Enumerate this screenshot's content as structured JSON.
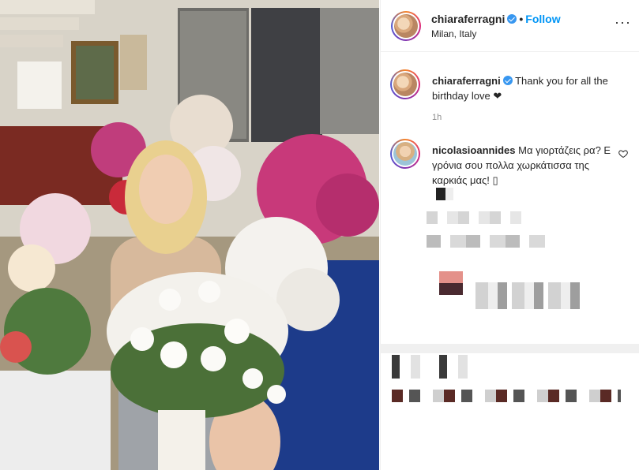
{
  "post": {
    "username": "chiaraferragni",
    "follow_label": "Follow",
    "dot": "•",
    "location": "Milan, Italy",
    "more_icon": "more-options-icon",
    "more_glyph": "···",
    "caption_text": "Thank you for all the birthday love ❤",
    "time_ago": "1h"
  },
  "comments": [
    {
      "username": "nicolasioannides",
      "text": "Μα γιορτάζεις ρα? Ε γρόνια σου πολλα χωρκάτισσα της καρκιάς μας! ▯",
      "icon": "heart-icon"
    }
  ],
  "colors": {
    "link_blue": "#0095f6",
    "verified_blue": "#3897f0",
    "muted_text": "#8e8e8e"
  }
}
